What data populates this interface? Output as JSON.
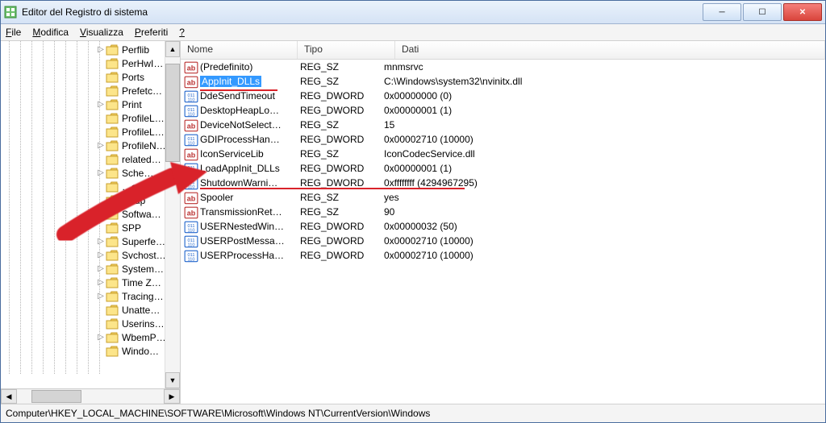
{
  "window": {
    "title": "Editor del Registro di sistema"
  },
  "menubar": [
    {
      "u": "F",
      "rest": "ile"
    },
    {
      "u": "M",
      "rest": "odifica"
    },
    {
      "u": "V",
      "rest": "isualizza"
    },
    {
      "u": "P",
      "rest": "referiti"
    },
    {
      "u": "?",
      "rest": ""
    }
  ],
  "tree": {
    "items": [
      {
        "exp": "▷",
        "label": "Perflib"
      },
      {
        "exp": "",
        "label": "PerHwI…"
      },
      {
        "exp": "",
        "label": "Ports"
      },
      {
        "exp": "",
        "label": "Prefetc…"
      },
      {
        "exp": "▷",
        "label": "Print"
      },
      {
        "exp": "",
        "label": "ProfileL…"
      },
      {
        "exp": "",
        "label": "ProfileL…"
      },
      {
        "exp": "▷",
        "label": "ProfileN…"
      },
      {
        "exp": "",
        "label": "related…"
      },
      {
        "exp": "▷",
        "label": "Sche…"
      },
      {
        "exp": "",
        "label": "…edi…"
      },
      {
        "exp": "",
        "label": "setup"
      },
      {
        "exp": "▷",
        "label": "Softwa…"
      },
      {
        "exp": "",
        "label": "SPP"
      },
      {
        "exp": "▷",
        "label": "Superfe…"
      },
      {
        "exp": "▷",
        "label": "Svchost…"
      },
      {
        "exp": "▷",
        "label": "System…"
      },
      {
        "exp": "▷",
        "label": "Time Z…"
      },
      {
        "exp": "▷",
        "label": "Tracing…"
      },
      {
        "exp": "",
        "label": "Unatte…"
      },
      {
        "exp": "",
        "label": "Userins…"
      },
      {
        "exp": "▷",
        "label": "WbemP…"
      },
      {
        "exp": "",
        "label": "Windo…"
      }
    ]
  },
  "columns": {
    "name": "Nome",
    "type": "Tipo",
    "data": "Dati"
  },
  "rows": [
    {
      "icon": "sz",
      "name": "(Predefinito)",
      "type": "REG_SZ",
      "data": "mnmsrvc",
      "sel": false
    },
    {
      "icon": "sz",
      "name": "AppInit_DLLs",
      "type": "REG_SZ",
      "data": "C:\\Windows\\system32\\nvinitx.dll",
      "sel": true
    },
    {
      "icon": "dw",
      "name": "DdeSendTimeout",
      "type": "REG_DWORD",
      "data": "0x00000000 (0)"
    },
    {
      "icon": "dw",
      "name": "DesktopHeapLo…",
      "type": "REG_DWORD",
      "data": "0x00000001 (1)"
    },
    {
      "icon": "sz",
      "name": "DeviceNotSelect…",
      "type": "REG_SZ",
      "data": "15"
    },
    {
      "icon": "dw",
      "name": "GDIProcessHan…",
      "type": "REG_DWORD",
      "data": "0x00002710 (10000)"
    },
    {
      "icon": "sz",
      "name": "IconServiceLib",
      "type": "REG_SZ",
      "data": "IconCodecService.dll"
    },
    {
      "icon": "dw",
      "name": "LoadAppInit_DLLs",
      "type": "REG_DWORD",
      "data": "0x00000001 (1)"
    },
    {
      "icon": "dw",
      "name": "ShutdownWarni…",
      "type": "REG_DWORD",
      "data": "0xffffffff (4294967295)"
    },
    {
      "icon": "sz",
      "name": "Spooler",
      "type": "REG_SZ",
      "data": "yes"
    },
    {
      "icon": "sz",
      "name": "TransmissionRet…",
      "type": "REG_SZ",
      "data": "90"
    },
    {
      "icon": "dw",
      "name": "USERNestedWin…",
      "type": "REG_DWORD",
      "data": "0x00000032 (50)"
    },
    {
      "icon": "dw",
      "name": "USERPostMessa…",
      "type": "REG_DWORD",
      "data": "0x00002710 (10000)"
    },
    {
      "icon": "dw",
      "name": "USERProcessHa…",
      "type": "REG_DWORD",
      "data": "0x00002710 (10000)"
    }
  ],
  "statusbar": "Computer\\HKEY_LOCAL_MACHINE\\SOFTWARE\\Microsoft\\Windows NT\\CurrentVersion\\Windows",
  "annotations": {
    "underline_appinit": true,
    "underline_loadappinit": true,
    "arrow": true
  }
}
